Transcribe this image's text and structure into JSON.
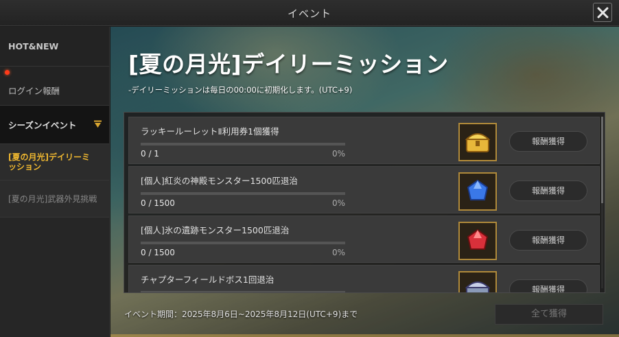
{
  "window": {
    "title": "イベント"
  },
  "sidebar": {
    "items": [
      {
        "label": "HOT&NEW"
      },
      {
        "label": "ログイン報酬",
        "notification": true
      },
      {
        "label": "シーズンイベント",
        "expanded": true
      },
      {
        "label": "[夏の月光]デイリーミッション",
        "selected": true
      },
      {
        "label": "[夏の月光]武器外見挑戦"
      }
    ]
  },
  "main": {
    "title": "[夏の月光]デイリーミッション",
    "subtitle": "-デイリーミッションは毎日の00:00に初期化します。(UTC+9)",
    "missions": [
      {
        "title": "ラッキールーレットⅡ利用券1個獲得",
        "progress_text": "0 / 1",
        "percent_text": "0%",
        "progress": 0,
        "reward_icon": "golden-chest-icon",
        "button": "報酬獲得"
      },
      {
        "title": "[個人]紅炎の神殿モンスター1500匹退治",
        "progress_text": "0 / 1500",
        "percent_text": "0%",
        "progress": 0,
        "reward_icon": "blue-gem-icon",
        "button": "報酬獲得"
      },
      {
        "title": "[個人]氷の遺跡モンスター1500匹退治",
        "progress_text": "0 / 1500",
        "percent_text": "0%",
        "progress": 0,
        "reward_icon": "red-gem-icon",
        "button": "報酬獲得"
      },
      {
        "title": "チャプターフィールドボス1回退治",
        "progress_text": "",
        "percent_text": "",
        "progress": 0,
        "reward_icon": "silver-chest-icon",
        "button": "報酬獲得"
      }
    ],
    "period": "イベント期間：2025年8月6日~2025年8月12日(UTC+9)まで",
    "claim_all": "全て獲得"
  },
  "colors": {
    "accent": "#f0b830",
    "progress_fill": "#d49a2a",
    "notification": "#ff3a1a"
  }
}
